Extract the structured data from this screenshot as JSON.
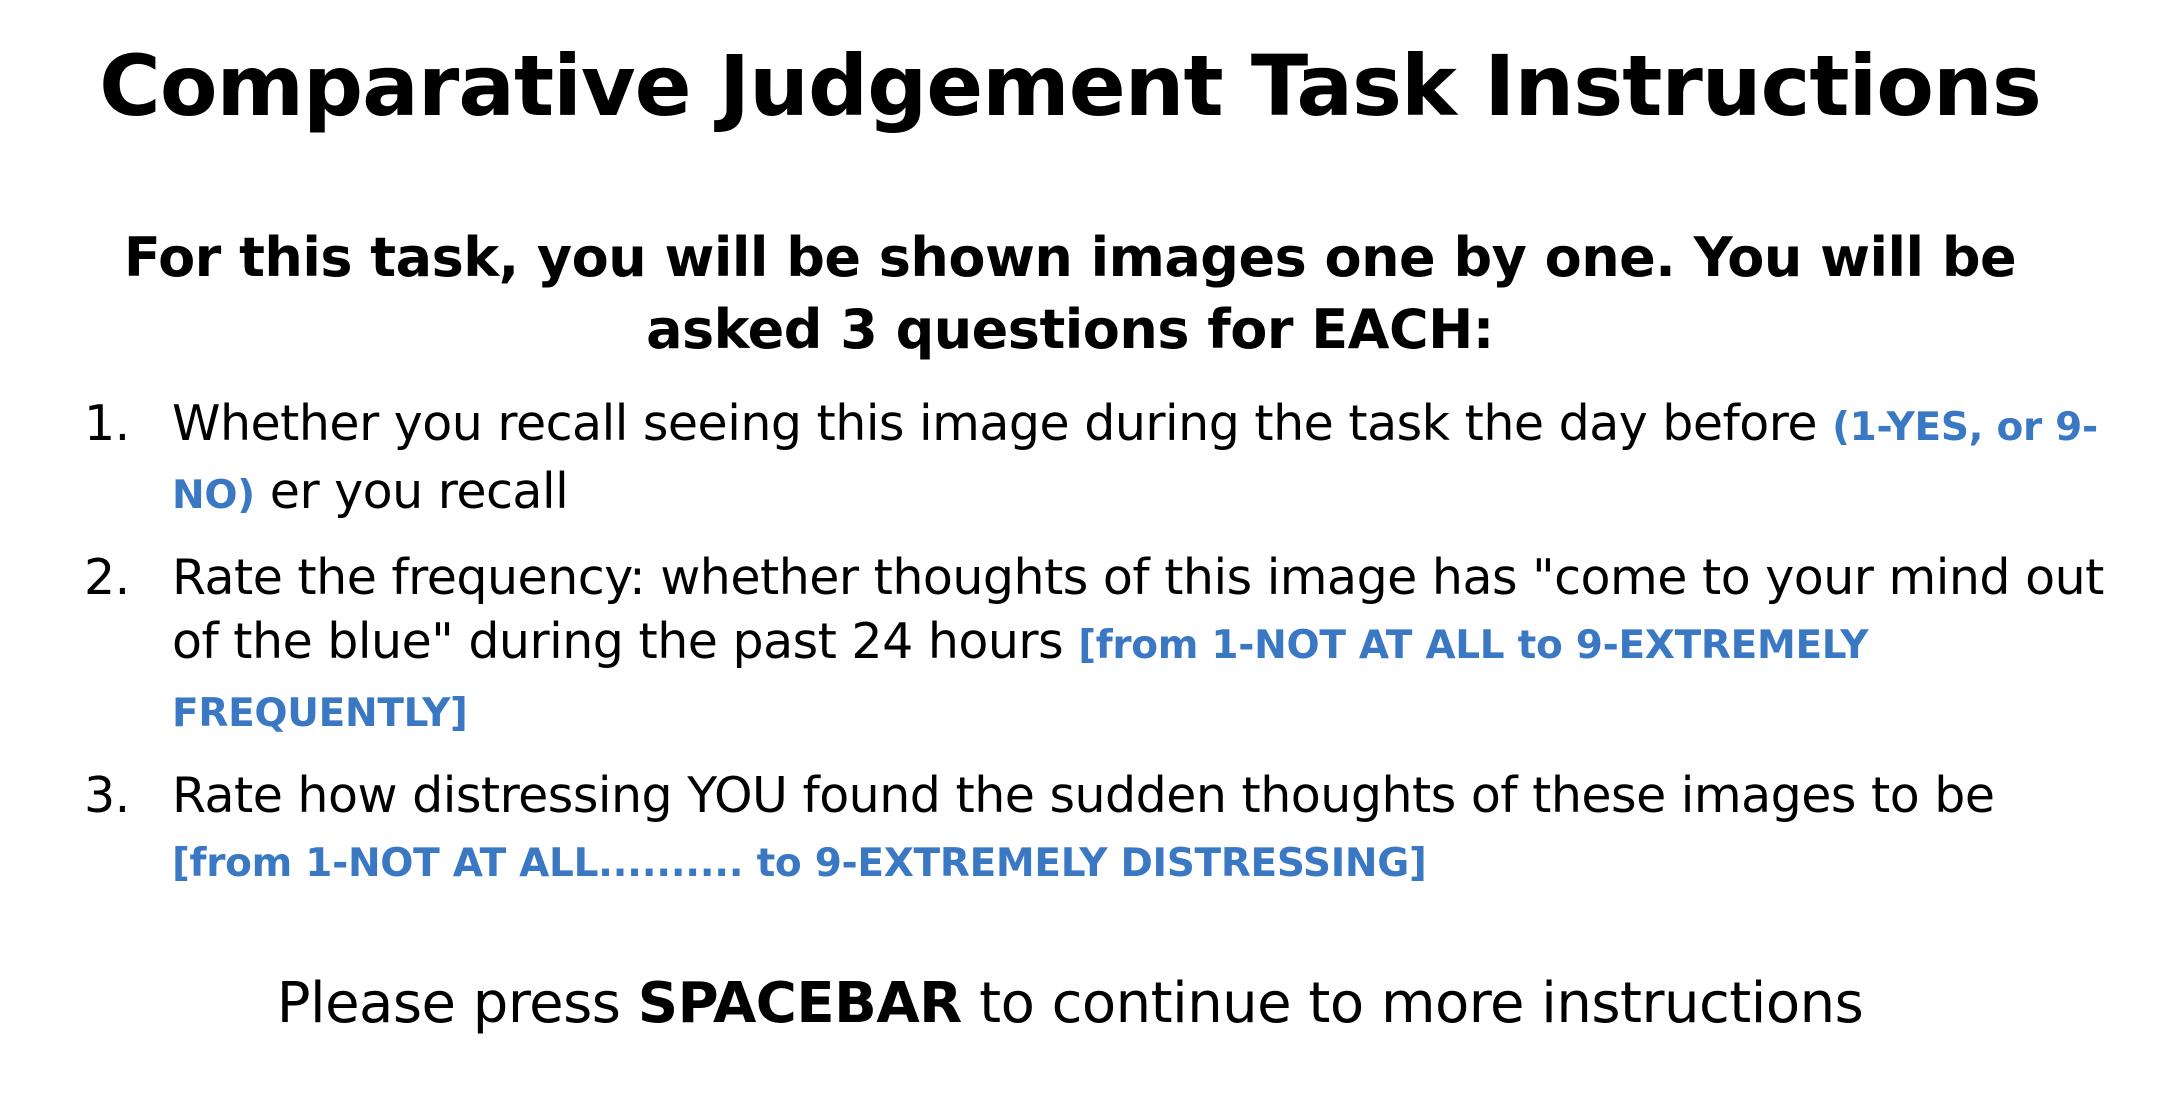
{
  "title": "Comparative Judgement Task Instructions",
  "intro": "For this task, you will be shown images one by one. You will be asked 3 questions for EACH:",
  "questions": [
    {
      "number": "1.",
      "text": "Whether you recall seeing this image during the task the day before ",
      "hint": "(1-YES, or 9-NO)",
      "trailing": " er you recall"
    },
    {
      "number": "2.",
      "text": "Rate the frequency: whether thoughts of this image has \"come to your mind out of the blue\" during the past 24 hours ",
      "hint": "[from 1-NOT AT ALL to 9-EXTREMELY FREQUENTLY]",
      "trailing": ""
    },
    {
      "number": "3.",
      "text": "Rate how distressing YOU found the sudden thoughts of these images to be ",
      "hint": "[from 1-NOT AT ALL.......... to 9-EXTREMELY DISTRESSING]",
      "trailing": ""
    }
  ],
  "footer": {
    "prefix": "Please press ",
    "key": "SPACEBAR",
    "suffix": " to continue to more instructions"
  },
  "colors": {
    "text": "#000000",
    "hint": "#3b78c4",
    "background": "#ffffff"
  }
}
